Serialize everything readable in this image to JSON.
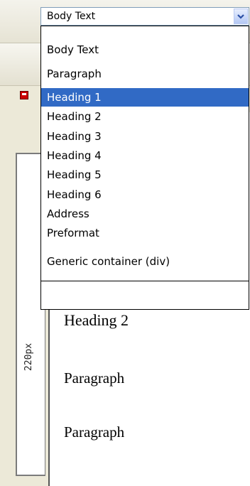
{
  "format_select": {
    "value": "Body Text"
  },
  "format_options": [
    {
      "label": "Body Text",
      "selected": false
    },
    {
      "label": "Paragraph",
      "selected": false
    },
    {
      "label": "Heading 1",
      "selected": true
    },
    {
      "label": "Heading 2",
      "selected": false
    },
    {
      "label": "Heading 3",
      "selected": false
    },
    {
      "label": "Heading 4",
      "selected": false
    },
    {
      "label": "Heading 5",
      "selected": false
    },
    {
      "label": "Heading 6",
      "selected": false
    },
    {
      "label": "Address",
      "selected": false
    },
    {
      "label": "Preformat",
      "selected": false
    },
    {
      "label": "Generic container (div)",
      "selected": false
    }
  ],
  "ruler": {
    "label": "220px"
  },
  "editor": {
    "lines": [
      "Heading 2",
      "Paragraph",
      "Paragraph"
    ]
  },
  "icons": {
    "dropdown_arrow": "chevron-down-icon",
    "save": "save-icon"
  },
  "colors": {
    "selection": "#316ac5",
    "select_border": "#7f9db9"
  }
}
